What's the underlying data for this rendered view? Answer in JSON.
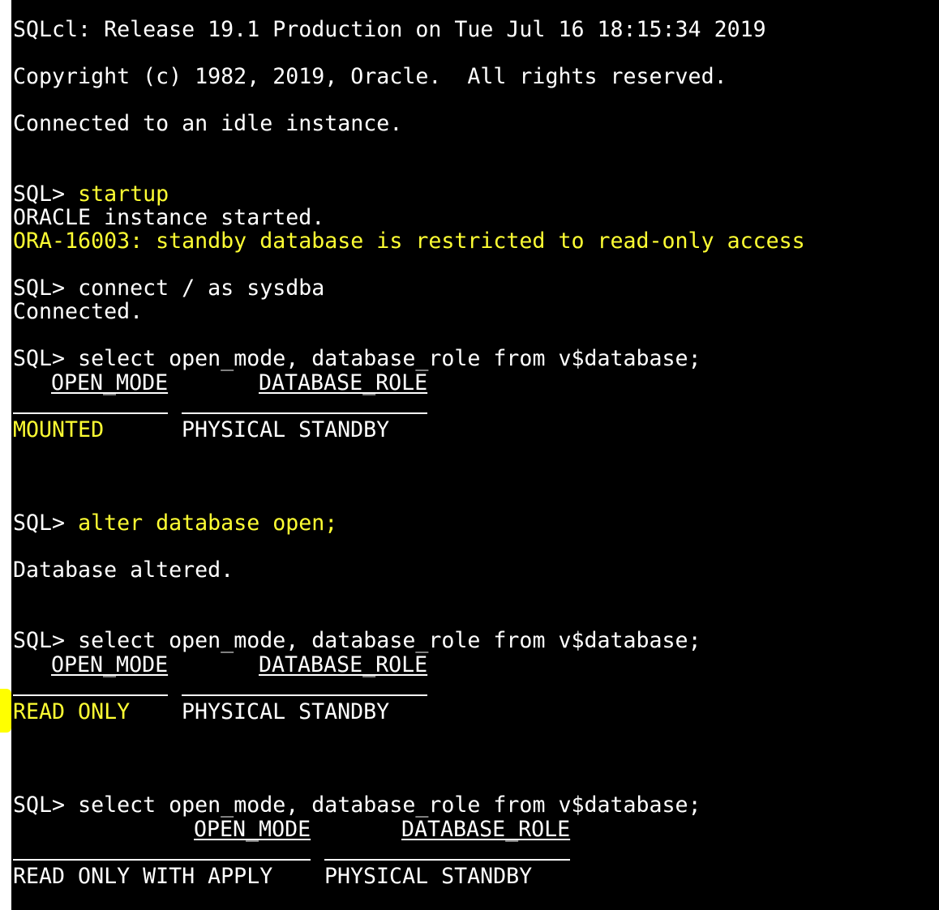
{
  "colors": {
    "background": "#000000",
    "text": "#ffffff",
    "highlight": "#ffff33"
  },
  "banner": {
    "release": "SQLcl: Release 19.1 Production on Tue Jul 16 18:15:34 2019",
    "copyright": "Copyright (c) 1982, 2019, Oracle.  All rights reserved.",
    "connected": "Connected to an idle instance."
  },
  "session": {
    "prompt": "SQL> ",
    "cmd_startup": "startup",
    "startup_msg": "ORACLE instance started.",
    "startup_err": "ORA-16003: standby database is restricted to read-only access",
    "cmd_connect": "connect / as sysdba",
    "connect_msg": "Connected.",
    "cmd_select": "select open_mode, database_role from v$database;",
    "cmd_alter": "alter database open;",
    "alter_msg": "Database altered."
  },
  "query1": {
    "col1": "OPEN_MODE",
    "col2": "DATABASE_ROLE",
    "open_mode": "MOUNTED",
    "database_role": "PHYSICAL STANDBY"
  },
  "query2": {
    "col1": "OPEN_MODE",
    "col2": "DATABASE_ROLE",
    "open_mode": "READ ONLY",
    "database_role": "PHYSICAL STANDBY"
  },
  "query3": {
    "col1": "OPEN_MODE",
    "col2": "DATABASE_ROLE",
    "open_mode": "READ ONLY WITH APPLY",
    "database_role": "PHYSICAL STANDBY"
  }
}
